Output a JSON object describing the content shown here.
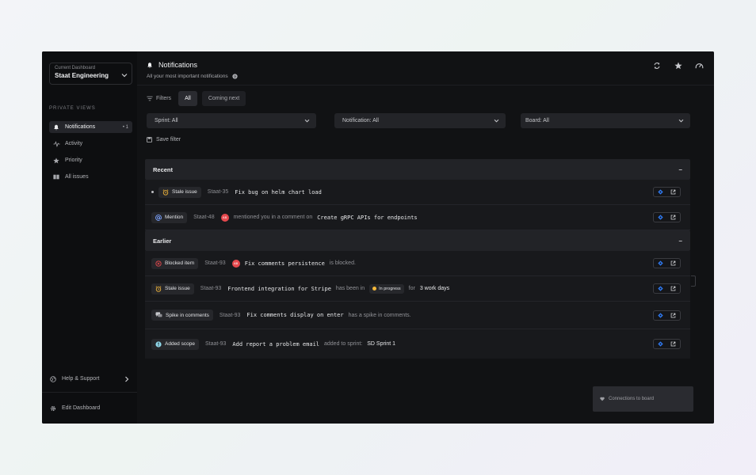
{
  "sidebar": {
    "dashboard_label": "Current Dashboard",
    "dashboard_value": "Staat Engineering",
    "section_label": "PRIVATE VIEWS",
    "items": [
      {
        "label": "Notifications",
        "count": "• 1",
        "icon": "bell-icon"
      },
      {
        "label": "Activity",
        "count": "",
        "icon": "activity-icon"
      },
      {
        "label": "Priority",
        "count": "",
        "icon": "star-icon"
      },
      {
        "label": "All issues",
        "count": "",
        "icon": "board-icon"
      }
    ],
    "help_label": "Help & Support",
    "edit_label": "Edit Dashboard"
  },
  "header": {
    "title": "Notifications",
    "subtitle": "All your most important notifications"
  },
  "filters": {
    "label": "Filters",
    "chips": [
      "All",
      "Coming next"
    ],
    "sprint": "Sprint:  All",
    "notification": "Notification: All",
    "board": "Board: All",
    "save_label": "Save filter"
  },
  "groups": {
    "recent": "Recent",
    "earlier": "Earlier",
    "collapse": "–"
  },
  "rows": [
    {
      "tag": "Stale issue",
      "key": "Staat-35",
      "title": "Fix bug on helm chart load"
    },
    {
      "tag": "Mention",
      "key": "Staat-48",
      "avatar": "AB",
      "text": "mentioned you in a comment on",
      "title": "Create gRPC APIs for endpoints"
    },
    {
      "tag": "Blocked item",
      "key": "Staat-93",
      "avatar": "AB",
      "title": "Fix comments persistence",
      "text": "is blocked."
    },
    {
      "tag": "Stale issue",
      "key": "Staat-93",
      "title": "Frontend integration for Stripe",
      "text": "has been in",
      "status": "In progress",
      "text2": "for",
      "strong": "3 work days"
    },
    {
      "tag": "Spike in comments",
      "key": "Staat-93",
      "title": "Fix comments display on enter",
      "text": "has a spike in comments."
    },
    {
      "tag": "Added scope",
      "key": "Staat-93",
      "title": "Add report a problem email",
      "text": "added to sprint:",
      "strong": "SD Sprint 1"
    }
  ],
  "connections_label": "Connections to board",
  "colors": {
    "accent": "#2f7bf5",
    "danger": "#e5484d",
    "warning": "#f5b83a"
  }
}
